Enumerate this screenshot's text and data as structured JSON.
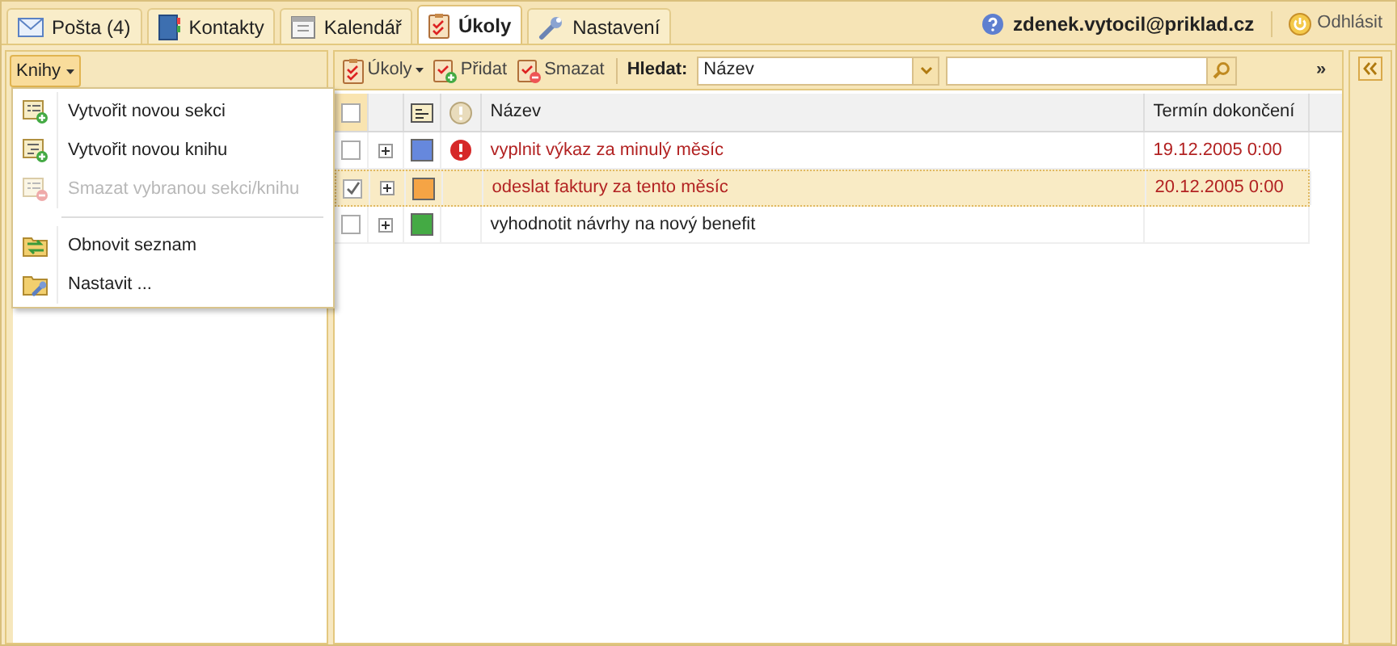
{
  "tabs": [
    {
      "label": "Pošta (4)",
      "selected": false
    },
    {
      "label": "Kontakty",
      "selected": false
    },
    {
      "label": "Kalendář",
      "selected": false
    },
    {
      "label": "Úkoly",
      "selected": true
    },
    {
      "label": "Nastavení",
      "selected": false
    }
  ],
  "user": {
    "email": "zdenek.vytocil@priklad.cz",
    "logout": "Odhlásit"
  },
  "books_button": {
    "label": "Knihy"
  },
  "books_menu": [
    {
      "kind": "item",
      "label": "Vytvořit novou sekci",
      "disabled": false
    },
    {
      "kind": "item",
      "label": "Vytvořit novou knihu",
      "disabled": false
    },
    {
      "kind": "item",
      "label": "Smazat vybranou sekci/knihu",
      "disabled": true
    },
    {
      "kind": "separator"
    },
    {
      "kind": "item",
      "label": "Obnovit seznam",
      "disabled": false
    },
    {
      "kind": "item",
      "label": "Nastavit ...",
      "disabled": false
    }
  ],
  "toolbar": {
    "tasks": "Úkoly",
    "add": "Přidat",
    "delete": "Smazat",
    "search_label": "Hledat:",
    "search_field": "Název",
    "more": "»"
  },
  "table": {
    "all_checked": false,
    "columns": [
      "Název",
      "Termín dokončení"
    ],
    "rows": [
      {
        "name": "vyplnit výkaz za minulý měsíc",
        "due": "19.12.2005 0:00",
        "checked": false,
        "selected": false,
        "overdue": true,
        "high_priority": true,
        "color": "#6688dd"
      },
      {
        "name": "odeslat faktury za tento měsíc",
        "due": "20.12.2005 0:00",
        "checked": true,
        "selected": true,
        "overdue": true,
        "high_priority": false,
        "color": "#f5a445"
      },
      {
        "name": "vyhodnotit návrhy na nový benefit",
        "checked": false,
        "selected": false,
        "overdue": false,
        "high_priority": false,
        "color": "#44aa44"
      }
    ]
  }
}
